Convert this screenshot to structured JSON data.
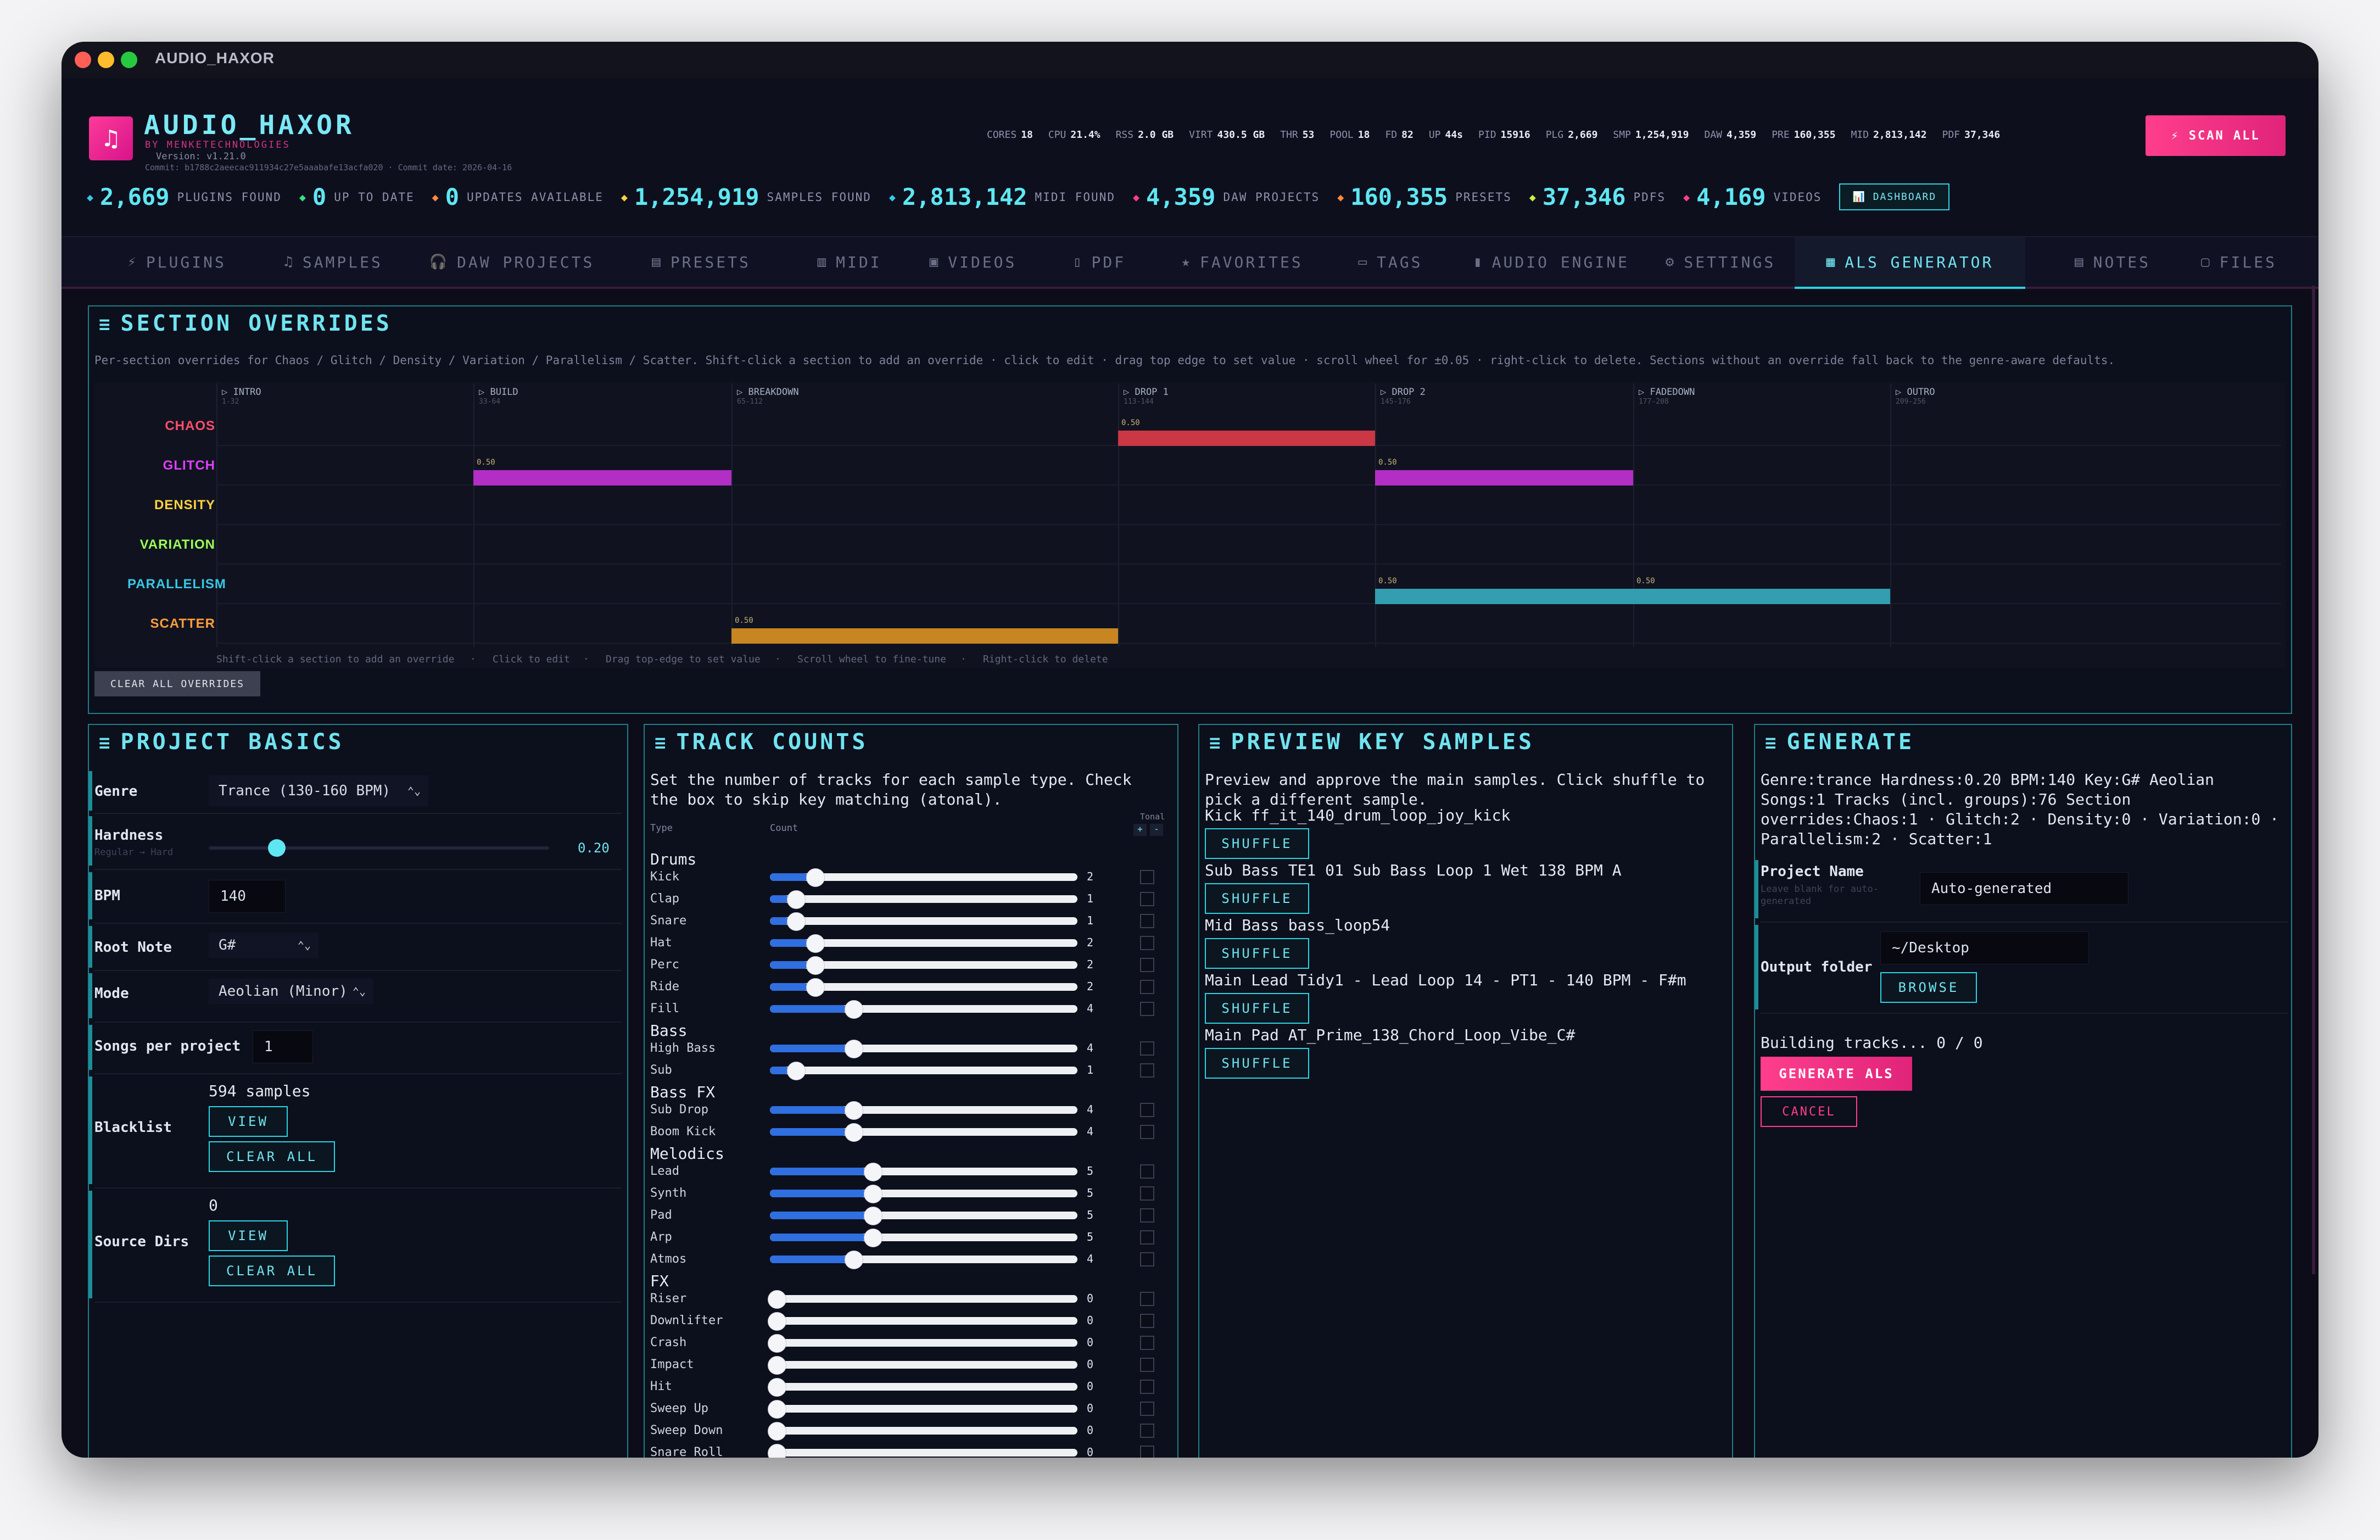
{
  "window": {
    "title": "AUDIO_HAXOR"
  },
  "brand": {
    "name": "AUDIO_HAXOR",
    "by": "BY MENKETECHNOLOGIES",
    "version": "Version: v1.21.0",
    "commit": "Commit: b1788c2aeecac911934c27e5aaabafe13acfa020 · Commit date: 2026-04-16"
  },
  "system_stats": [
    {
      "label": "CORES",
      "value": "18"
    },
    {
      "label": "CPU",
      "value": "21.4%"
    },
    {
      "label": "RSS",
      "value": "2.0 GB"
    },
    {
      "label": "VIRT",
      "value": "430.5 GB"
    },
    {
      "label": "THR",
      "value": "53"
    },
    {
      "label": "POOL",
      "value": "18"
    },
    {
      "label": "FD",
      "value": "82"
    },
    {
      "label": "UP",
      "value": "44s"
    },
    {
      "label": "PID",
      "value": "15916"
    },
    {
      "label": "PLG",
      "value": "2,669"
    },
    {
      "label": "SMP",
      "value": "1,254,919"
    },
    {
      "label": "DAW",
      "value": "4,359"
    },
    {
      "label": "PRE",
      "value": "160,355"
    },
    {
      "label": "MID",
      "value": "2,813,142"
    },
    {
      "label": "PDF",
      "value": "37,346"
    }
  ],
  "scan_button": "⚡ SCAN ALL",
  "counters": [
    {
      "value": "2,669",
      "label": "PLUGINS FOUND",
      "color": "#37c7e6"
    },
    {
      "value": "0",
      "label": "UP TO DATE",
      "color": "#3ddc84"
    },
    {
      "value": "0",
      "label": "UPDATES AVAILABLE",
      "color": "#ff8a3d"
    },
    {
      "value": "1,254,919",
      "label": "SAMPLES FOUND",
      "color": "#ffd23f"
    },
    {
      "value": "2,813,142",
      "label": "MIDI FOUND",
      "color": "#37c7e6"
    },
    {
      "value": "4,359",
      "label": "DAW PROJECTS",
      "color": "#ff3e8c"
    },
    {
      "value": "160,355",
      "label": "PRESETS",
      "color": "#ff8a3d"
    },
    {
      "value": "37,346",
      "label": "PDFS",
      "color": "#c6f04a"
    },
    {
      "value": "4,169",
      "label": "VIDEOS",
      "color": "#ff3e8c"
    }
  ],
  "dashboard_button": "📊 DASHBOARD",
  "tabs": [
    {
      "icon": "⚡",
      "label": "PLUGINS"
    },
    {
      "icon": "♫",
      "label": "SAMPLES"
    },
    {
      "icon": "🎧",
      "label": "DAW PROJECTS"
    },
    {
      "icon": "▤",
      "label": "PRESETS"
    },
    {
      "icon": "▥",
      "label": "MIDI"
    },
    {
      "icon": "▣",
      "label": "VIDEOS"
    },
    {
      "icon": "▯",
      "label": "PDF"
    },
    {
      "icon": "★",
      "label": "FAVORITES"
    },
    {
      "icon": "▭",
      "label": "TAGS"
    },
    {
      "icon": "▮",
      "label": "AUDIO ENGINE"
    },
    {
      "icon": "⚙",
      "label": "SETTINGS"
    },
    {
      "icon": "▦",
      "label": "ALS GENERATOR"
    },
    {
      "icon": "▤",
      "label": "NOTES"
    },
    {
      "icon": "▢",
      "label": "FILES"
    }
  ],
  "overrides": {
    "title": "SECTION OVERRIDES",
    "description": "Per-section overrides for Chaos / Glitch / Density / Variation / Parallelism / Scatter. Shift-click a section to add an override · click to edit · drag top edge to set value · scroll wheel for ±0.05 · right-click to delete. Sections without an override fall back to the genre-aware defaults.",
    "sections": [
      {
        "name": "▷ INTRO",
        "range": "1-32"
      },
      {
        "name": "▷ BUILD",
        "range": "33-64"
      },
      {
        "name": "▷ BREAKDOWN",
        "range": "65-112"
      },
      {
        "name": "▷ DROP 1",
        "range": "113-144"
      },
      {
        "name": "▷ DROP 2",
        "range": "145-176"
      },
      {
        "name": "▷ FADEDOWN",
        "range": "177-208"
      },
      {
        "name": "▷ OUTRO",
        "range": "209-256"
      }
    ],
    "rows": [
      {
        "label": "CHAOS",
        "color": "#ff4d6d"
      },
      {
        "label": "GLITCH",
        "color": "#e040fb"
      },
      {
        "label": "DENSITY",
        "color": "#ffd23f"
      },
      {
        "label": "VARIATION",
        "color": "#9cff57"
      },
      {
        "label": "PARALLELISM",
        "color": "#37c7e6"
      },
      {
        "label": "SCATTER",
        "color": "#ff9d3d"
      }
    ],
    "bars": [
      {
        "row": 0,
        "section": 3,
        "value": "0.50",
        "color": "#b8323f"
      },
      {
        "row": 1,
        "section": 1,
        "value": "0.50",
        "color": "#a22ab3"
      },
      {
        "row": 1,
        "section": 4,
        "value": "0.50",
        "color": "#a22ab3"
      },
      {
        "row": 4,
        "section": 4,
        "value": "0.50",
        "color": "#2f8fa0"
      },
      {
        "row": 4,
        "section": 5,
        "value": "0.50",
        "color": "#2f8fa0"
      },
      {
        "row": 5,
        "section": 2,
        "value": "0.50",
        "color": "#b57a1f"
      }
    ],
    "hints": [
      "Shift-click a section to add an override",
      "·",
      "Click to edit",
      "·",
      "Drag top-edge to set value",
      "·",
      "Scroll wheel to fine-tune",
      "·",
      "Right-click to delete"
    ],
    "clear_button": "CLEAR ALL OVERRIDES"
  },
  "basics": {
    "title": "PROJECT BASICS",
    "genre_label": "Genre",
    "genre_value": "Trance (130-160 BPM)",
    "hardness_label": "Hardness",
    "hardness_sub": "Regular → Hard",
    "hardness_value": "0.20",
    "hardness_level": 0.2,
    "bpm_label": "BPM",
    "bpm_value": "140",
    "root_label": "Root Note",
    "root_value": "G#",
    "mode_label": "Mode",
    "mode_value": "Aeolian (Minor)",
    "songs_label": "Songs per project",
    "songs_value": "1",
    "blacklist_label": "Blacklist",
    "blacklist_count": "594 samples",
    "view_label": "VIEW",
    "clear_label": "CLEAR ALL",
    "source_label": "Source Dirs",
    "source_count": "0"
  },
  "track_counts": {
    "title": "TRACK COUNTS",
    "description": "Set the number of tracks for each sample type. Check the box to skip key matching (atonal).",
    "col_type": "Type",
    "col_count": "Count",
    "col_tonal": "Tonal",
    "tonal_plus": "+",
    "tonal_minus": "-",
    "max": 16,
    "groups": [
      {
        "name": "Drums",
        "rows": [
          {
            "label": "Kick",
            "value": 2
          },
          {
            "label": "Clap",
            "value": 1
          },
          {
            "label": "Snare",
            "value": 1
          },
          {
            "label": "Hat",
            "value": 2
          },
          {
            "label": "Perc",
            "value": 2
          },
          {
            "label": "Ride",
            "value": 2
          },
          {
            "label": "Fill",
            "value": 4
          }
        ]
      },
      {
        "name": "Bass",
        "rows": [
          {
            "label": "High Bass",
            "value": 4
          },
          {
            "label": "Sub",
            "value": 1
          }
        ]
      },
      {
        "name": "Bass FX",
        "rows": [
          {
            "label": "Sub Drop",
            "value": 4
          },
          {
            "label": "Boom Kick",
            "value": 4
          }
        ]
      },
      {
        "name": "Melodics",
        "rows": [
          {
            "label": "Lead",
            "value": 5
          },
          {
            "label": "Synth",
            "value": 5
          },
          {
            "label": "Pad",
            "value": 5
          },
          {
            "label": "Arp",
            "value": 5
          },
          {
            "label": "Atmos",
            "value": 4
          }
        ]
      },
      {
        "name": "FX",
        "rows": [
          {
            "label": "Riser",
            "value": 0
          },
          {
            "label": "Downlifter",
            "value": 0
          },
          {
            "label": "Crash",
            "value": 0
          },
          {
            "label": "Impact",
            "value": 0
          },
          {
            "label": "Hit",
            "value": 0
          },
          {
            "label": "Sweep Up",
            "value": 0
          },
          {
            "label": "Sweep Down",
            "value": 0
          },
          {
            "label": "Snare Roll",
            "value": 0
          }
        ]
      }
    ]
  },
  "preview": {
    "title": "PREVIEW KEY SAMPLES",
    "description": "Preview and approve the main samples. Click shuffle to pick a different sample.",
    "shuffle_label": "SHUFFLE",
    "samples": [
      "Kick ff_it_140_drum_loop_joy_kick",
      "Sub Bass TE1 01 Sub Bass Loop 1 Wet 138 BPM A",
      "Mid Bass bass_loop54",
      "Main Lead Tidy1 - Lead Loop 14 - PT1 - 140 BPM - F#m",
      "Main Pad AT_Prime_138_Chord_Loop_Vibe_C#"
    ]
  },
  "generate": {
    "title": "GENERATE",
    "summary": "Genre:trance Hardness:0.20 BPM:140 Key:G# Aeolian Songs:1 Tracks (incl. groups):76 Section overrides:Chaos:1 · Glitch:2 · Density:0 · Variation:0 · Parallelism:2 · Scatter:1",
    "project_name_label": "Project Name",
    "project_name_sub": "Leave blank for auto-generated",
    "project_name_placeholder": "Auto-generated",
    "output_label": "Output folder",
    "output_value": "~/Desktop",
    "browse_label": "BROWSE",
    "progress_text": "Building tracks... 0 / 0",
    "generate_label": "GENERATE ALS",
    "cancel_label": "CANCEL"
  }
}
